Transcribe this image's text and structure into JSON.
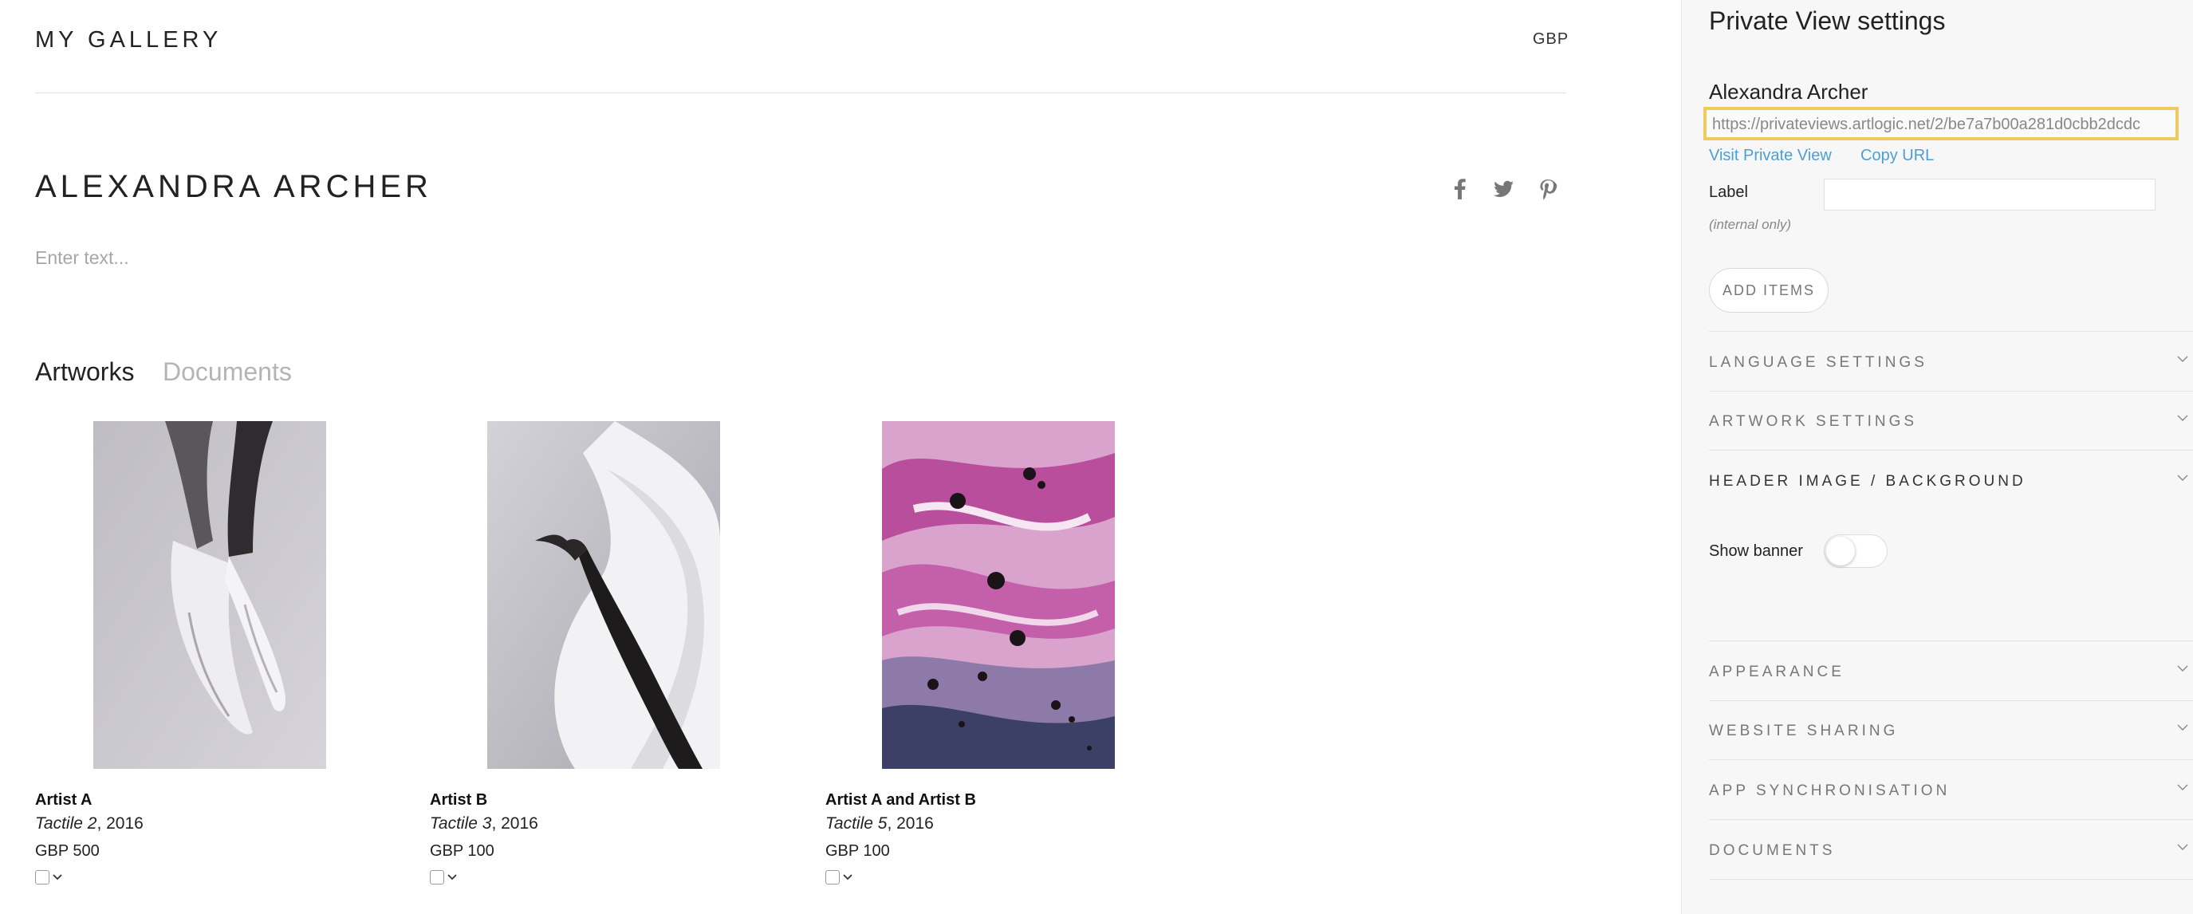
{
  "header": {
    "gallery_name": "MY GALLERY",
    "currency": "GBP"
  },
  "main": {
    "artist_title": "ALEXANDRA ARCHER",
    "description_placeholder": "Enter text...",
    "social_icons": [
      "facebook-icon",
      "twitter-icon",
      "pinterest-icon"
    ],
    "tabs": [
      {
        "label": "Artworks",
        "active": true
      },
      {
        "label": "Documents",
        "active": false
      }
    ],
    "artworks": [
      {
        "artist": "Artist A",
        "title": "Tactile 2",
        "year": ", 2016",
        "price": "GBP 500"
      },
      {
        "artist": "Artist B",
        "title": "Tactile 3",
        "year": ", 2016",
        "price": "GBP 100"
      },
      {
        "artist": "Artist A and Artist B",
        "title": "Tactile 5",
        "year": ", 2016",
        "price": "GBP 100"
      }
    ]
  },
  "panel": {
    "title": "Private View settings",
    "artist_name": "Alexandra Archer",
    "url": "https://privateviews.artlogic.net/2/be7a7b00a281d0cbb2dcdc",
    "visit_link": "Visit Private View",
    "copy_link": "Copy URL",
    "label_field_label": "Label",
    "label_field_value": "",
    "label_note": "(internal only)",
    "add_items_button": "ADD ITEMS",
    "sections": [
      {
        "label": "LANGUAGE SETTINGS",
        "expanded": false
      },
      {
        "label": "ARTWORK SETTINGS",
        "expanded": false
      },
      {
        "label": "HEADER IMAGE / BACKGROUND",
        "expanded": true
      },
      {
        "label": "APPEARANCE",
        "expanded": false
      },
      {
        "label": "WEBSITE SHARING",
        "expanded": false
      },
      {
        "label": "APP SYNCHRONISATION",
        "expanded": false
      },
      {
        "label": "DOCUMENTS",
        "expanded": false
      }
    ],
    "show_banner_label": "Show banner",
    "show_banner_on": false
  },
  "colors": {
    "highlight_border": "#f0c95f",
    "link": "#4a9fd8",
    "panel_bg": "#f7f7f7"
  }
}
